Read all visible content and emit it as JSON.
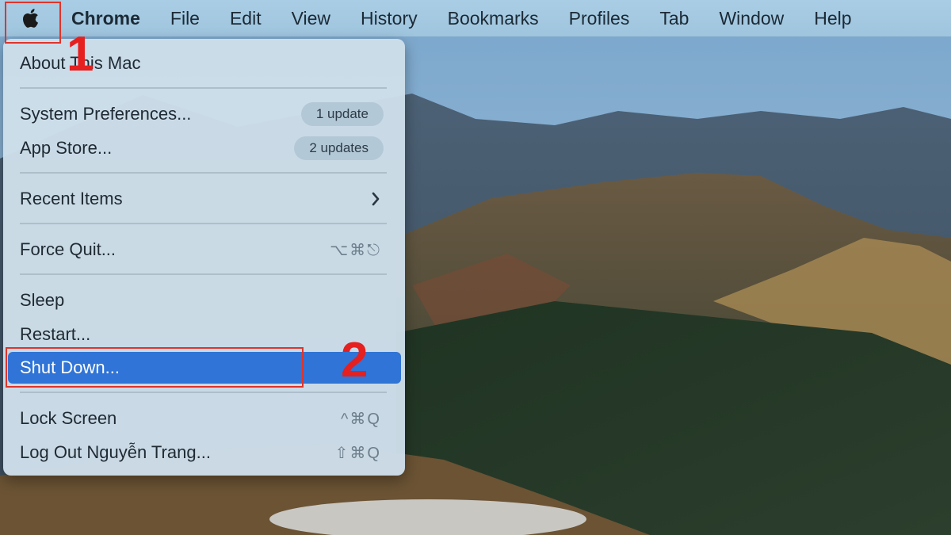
{
  "menubar": {
    "apple_icon": "apple-logo-icon",
    "app_name": "Chrome",
    "items": [
      "File",
      "Edit",
      "View",
      "History",
      "Bookmarks",
      "Profiles",
      "Tab",
      "Window",
      "Help"
    ]
  },
  "menu": {
    "about": "About This Mac",
    "system_prefs": "System Preferences...",
    "system_prefs_badge": "1 update",
    "app_store": "App Store...",
    "app_store_badge": "2 updates",
    "recent_items": "Recent Items",
    "force_quit": "Force Quit...",
    "force_quit_shortcut": "⌥⌘⎋",
    "sleep": "Sleep",
    "restart": "Restart...",
    "shut_down": "Shut Down...",
    "lock_screen": "Lock Screen",
    "lock_screen_shortcut": "^⌘Q",
    "log_out": "Log Out Nguyễn Trang...",
    "log_out_shortcut": "⇧⌘Q"
  },
  "annotations": {
    "step1": "1",
    "step2": "2",
    "color": "#e61f1f"
  },
  "colors": {
    "highlight": "#2f74d6",
    "menubar": "#a9cde4"
  }
}
